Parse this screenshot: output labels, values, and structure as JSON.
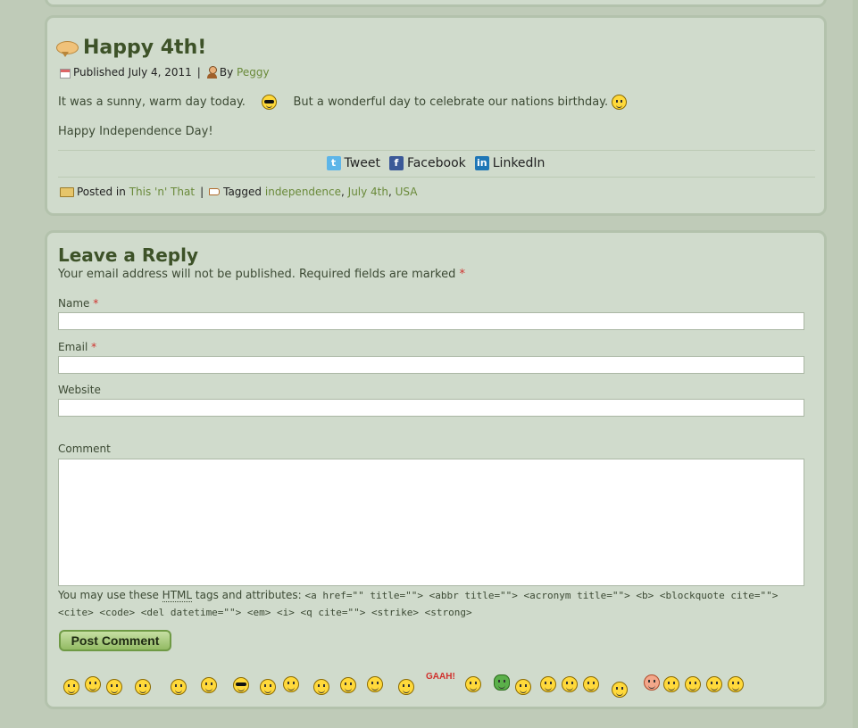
{
  "post": {
    "title": "Happy 4th!",
    "published": "Published July 4, 2011",
    "by": "By",
    "author": "Peggy",
    "line1_a": "It was a sunny, warm day today.",
    "line1_b": "But a wonderful day to celebrate our nations birthday.",
    "line2": "Happy Independence Day!",
    "share": {
      "tweet": "Tweet",
      "facebook": "Facebook",
      "linkedin": "LinkedIn"
    },
    "posted_in_label": "Posted in",
    "category": "This 'n' That",
    "tagged_label": "Tagged",
    "tags": [
      "independence",
      "July 4th",
      "USA"
    ],
    "sep": "|"
  },
  "reply": {
    "heading": "Leave a Reply",
    "note": "Your email address will not be published. Required fields are marked",
    "required_mark": "*",
    "name_label": "Name",
    "email_label": "Email",
    "website_label": "Website",
    "comment_label": "Comment",
    "allowed_prefix": "You may use these",
    "allowed_abbr": "HTML",
    "allowed_suffix": "tags and attributes:",
    "allowed_code": "<a href=\"\" title=\"\"> <abbr title=\"\"> <acronym title=\"\"> <b> <blockquote cite=\"\"> <cite> <code> <del datetime=\"\"> <em> <i> <q cite=\"\"> <strike> <strong>",
    "submit_label": "Post Comment",
    "gaah": "GAAH!"
  },
  "icons": {
    "bubble": "speech-bubble-icon",
    "calendar": "calendar-icon",
    "user": "user-icon",
    "twitter": "twitter-icon",
    "facebook": "facebook-icon",
    "linkedin": "linkedin-icon",
    "folder": "folder-icon",
    "tag": "tag-icon",
    "smiley": "smiley-icon"
  },
  "colors": {
    "page_bg": "#bfcbb8",
    "panel_bg": "#d0dbcc",
    "title": "#3d5228",
    "link": "#6a8a3a",
    "required": "#d0312d",
    "button": "#93bb64"
  }
}
